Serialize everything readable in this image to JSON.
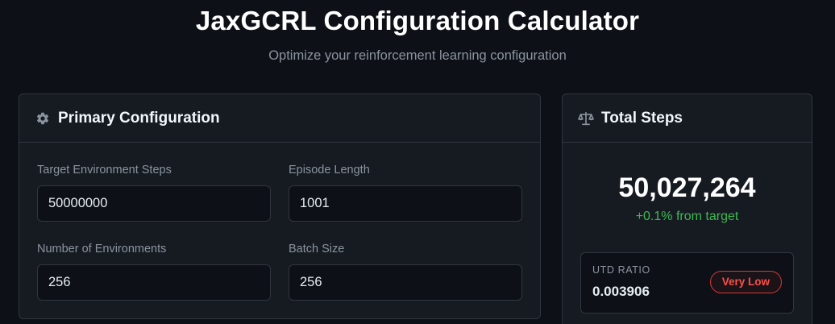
{
  "header": {
    "title": "JaxGCRL Configuration Calculator",
    "subtitle": "Optimize your reinforcement learning configuration"
  },
  "primary": {
    "title": "Primary Configuration",
    "icon": "gear-icon",
    "fields": {
      "target_steps": {
        "label": "Target Environment Steps",
        "value": "50000000"
      },
      "episode_length": {
        "label": "Episode Length",
        "value": "1001"
      },
      "num_envs": {
        "label": "Number of Environments",
        "value": "256"
      },
      "batch_size": {
        "label": "Batch Size",
        "value": "256"
      }
    }
  },
  "total": {
    "title": "Total Steps",
    "icon": "scale-icon",
    "value": "50,027,264",
    "delta": "+0.1% from target",
    "utd": {
      "label": "UTD RATIO",
      "value": "0.003906",
      "badge": "Very Low"
    }
  },
  "colors": {
    "background": "#0d1117",
    "card": "#161b22",
    "border": "#30363d",
    "positive": "#3fb950",
    "badge_danger": "#f85149"
  }
}
